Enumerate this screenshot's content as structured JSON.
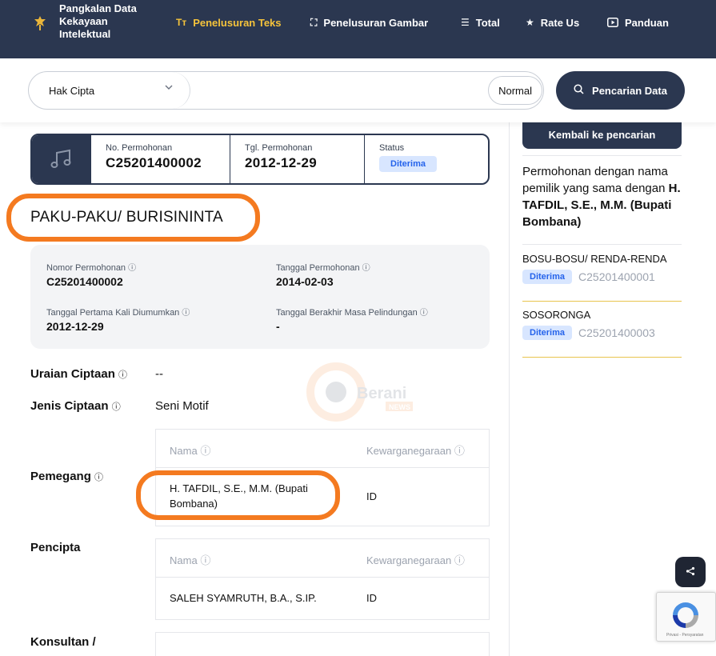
{
  "navbar": {
    "brand_lines": [
      "Pangkalan Data",
      "Kekayaan",
      "Intelektual"
    ],
    "items": [
      {
        "label": "Penelusuran Teks",
        "icon": "text-search-icon",
        "active": true
      },
      {
        "label": "Penelusuran Gambar",
        "icon": "image-search-icon",
        "active": false
      },
      {
        "label": "Total",
        "icon": "list-icon",
        "active": false
      },
      {
        "label": "Rate Us",
        "icon": "star-icon",
        "active": false
      },
      {
        "label": "Panduan",
        "icon": "play-icon",
        "active": false
      }
    ]
  },
  "search": {
    "category": "Hak Cipta",
    "query": "",
    "mode": "Normal",
    "button_label": "Pencarian Data"
  },
  "record": {
    "header": {
      "no_label": "No. Permohonan",
      "no_value": "C25201400002",
      "tgl_label": "Tgl. Permohonan",
      "tgl_value": "2012-12-29",
      "status_label": "Status",
      "status_value": "Diterima"
    },
    "title": "PAKU-PAKU/ BURISININTA",
    "info": {
      "nomor_label": "Nomor Permohonan",
      "nomor_value": "C25201400002",
      "tanggal_label": "Tanggal Permohonan",
      "tanggal_value": "2014-02-03",
      "pertama_label": "Tanggal Pertama Kali Diumumkan",
      "pertama_value": "2012-12-29",
      "berakhir_label": "Tanggal Berakhir Masa Pelindungan",
      "berakhir_value": "-"
    },
    "uraian_label": "Uraian Ciptaan",
    "uraian_value": "--",
    "jenis_label": "Jenis Ciptaan",
    "jenis_value": "Seni Motif",
    "pemegang_label": "Pemegang",
    "pencipta_label": "Pencipta",
    "konsultan_label": "Konsultan /",
    "col_nama": "Nama",
    "col_kewarganegaraan": "Kewarganegaraan",
    "pemegang": {
      "nama": "H. TAFDIL, S.E., M.M. (Bupati Bombana)",
      "kewarganegaraan": "ID"
    },
    "pencipta": {
      "nama": "SALEH SYAMRUTH, B.A., S.IP.",
      "kewarganegaraan": "ID"
    }
  },
  "sidebar": {
    "back_label": "Kembali ke pencarian",
    "same_owner_prefix": "Permohonan dengan nama pemilik yang sama dengan ",
    "same_owner_name": "H. TAFDIL, S.E., M.M. (Bupati Bombana)",
    "related": [
      {
        "name": "BOSU-BOSU/ RENDA-RENDA",
        "status": "Diterima",
        "number": "C25201400001"
      },
      {
        "name": "SOSORONGA",
        "status": "Diterima",
        "number": "C25201400003"
      }
    ]
  },
  "watermark_text": [
    "Berani",
    "NEWS"
  ],
  "recaptcha_text": "Privasi - Persyaratan",
  "colors": {
    "navy": "#2b3750",
    "accent_yellow": "#f5c33b",
    "highlight_orange": "#f47a20",
    "badge_blue": "#2563eb"
  }
}
